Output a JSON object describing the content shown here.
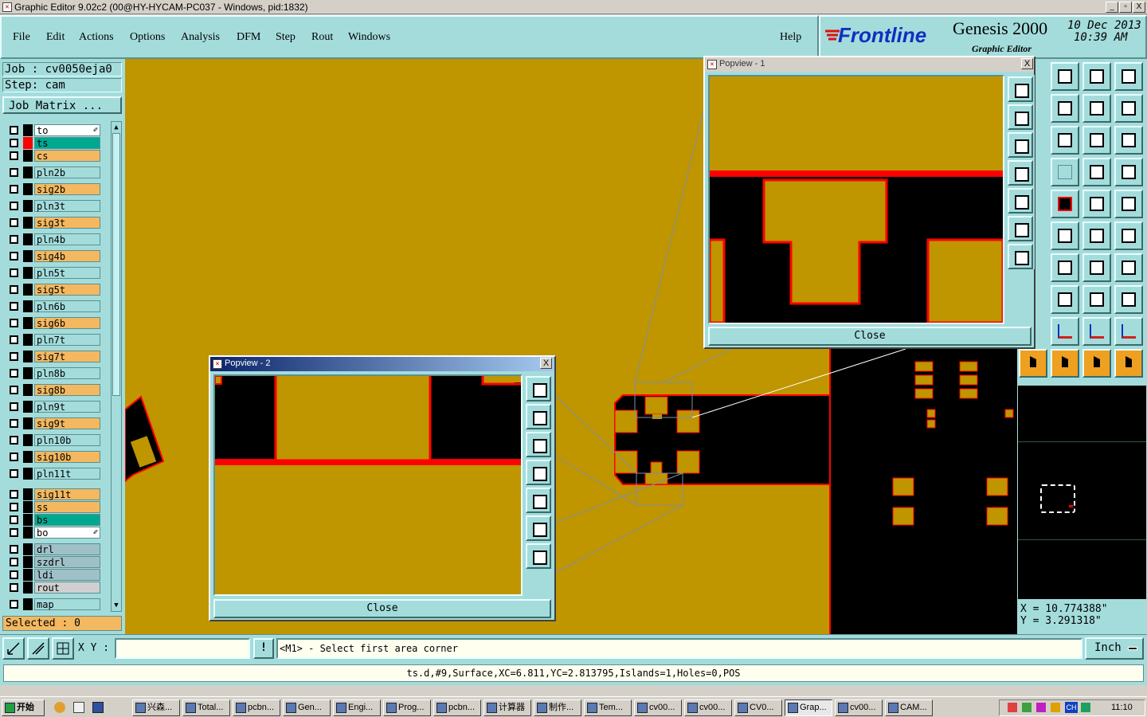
{
  "window": {
    "title": "Graphic Editor 9.02c2 (00@HY-HYCAM-PC037 - Windows, pid:1832)",
    "minimize": "_",
    "maximize": "▫",
    "close": "X"
  },
  "menu": {
    "items": [
      "File",
      "Edit",
      "Actions",
      "Options",
      "Analysis",
      "DFM",
      "Step",
      "Rout",
      "Windows"
    ],
    "help": "Help"
  },
  "brand": {
    "logo": "Frontline",
    "product": "Genesis 2000",
    "subtitle": "Graphic Editor",
    "date": "10 Dec 2013",
    "time": "10:39 AM"
  },
  "job": {
    "job_label": "Job : cv0050eja0",
    "step_label": "Step: cam",
    "matrix_button": "Job Matrix ..."
  },
  "layers": [
    {
      "name": "to",
      "color": "#ffffff",
      "mark": "✐"
    },
    {
      "name": "ts",
      "color": "#00a890",
      "affected": true
    },
    {
      "name": "cs",
      "color": "#f4b860"
    },
    {
      "name": "pln2b",
      "color": "#a4dcdc"
    },
    {
      "name": "sig2b",
      "color": "#f4b860"
    },
    {
      "name": "pln3t",
      "color": "#a4dcdc"
    },
    {
      "name": "sig3t",
      "color": "#f4b860"
    },
    {
      "name": "pln4b",
      "color": "#a4dcdc"
    },
    {
      "name": "sig4b",
      "color": "#f4b860"
    },
    {
      "name": "pln5t",
      "color": "#a4dcdc"
    },
    {
      "name": "sig5t",
      "color": "#f4b860"
    },
    {
      "name": "pln6b",
      "color": "#a4dcdc"
    },
    {
      "name": "sig6b",
      "color": "#f4b860"
    },
    {
      "name": "pln7t",
      "color": "#a4dcdc"
    },
    {
      "name": "sig7t",
      "color": "#f4b860"
    },
    {
      "name": "pln8b",
      "color": "#a4dcdc"
    },
    {
      "name": "sig8b",
      "color": "#f4b860"
    },
    {
      "name": "pln9t",
      "color": "#a4dcdc"
    },
    {
      "name": "sig9t",
      "color": "#f4b860"
    },
    {
      "name": "pln10b",
      "color": "#a4dcdc"
    },
    {
      "name": "sig10b",
      "color": "#f4b860"
    },
    {
      "name": "pln11t",
      "color": "#a4dcdc"
    },
    {
      "name": "sig11t",
      "color": "#f4b860"
    },
    {
      "name": "ss",
      "color": "#f4b860"
    },
    {
      "name": "bs",
      "color": "#00a890"
    },
    {
      "name": "bo",
      "color": "#ffffff",
      "mark": "✐"
    },
    {
      "name": "drl",
      "color": "#a0c0c8"
    },
    {
      "name": "szdrl",
      "color": "#a0c0c8"
    },
    {
      "name": "ldi",
      "color": "#a0c0c8"
    },
    {
      "name": "rout",
      "color": "#d0d0d0"
    },
    {
      "name": "map",
      "color": "#a4dcdc"
    }
  ],
  "selected": "Selected : 0",
  "popview1": {
    "title": "Popview - 1",
    "close": "Close",
    "x_label": "X"
  },
  "popview2": {
    "title": "Popview - 2",
    "close": "Close",
    "x_label": "X"
  },
  "coords": {
    "x": "X = 10.774388\"",
    "y": "Y = 3.291318\""
  },
  "bottom": {
    "xy_label": "X Y :",
    "xy_value": "",
    "warn": "!",
    "prompt": "<M1> - Select first area corner",
    "units": "Inch"
  },
  "status": "ts.d,#9,Surface,XC=6.811,YC=2.813795,Islands=1,Holes=0,POS",
  "taskbar": {
    "start": "开始",
    "tasks": [
      "兴森...",
      "Total...",
      "pcbn...",
      "Gen...",
      "Engi...",
      "Prog...",
      "pcbn...",
      "计算器",
      "制作...",
      "Tem...",
      "cv00...",
      "cv00...",
      "CV0...",
      "Grap...",
      "cv00...",
      "CAM..."
    ],
    "clock": "11:10",
    "tray": "CH"
  },
  "colors": {
    "copper": "#bf9500",
    "outline": "#ff0000",
    "panel": "#a4dcdc",
    "background": "#000000"
  }
}
